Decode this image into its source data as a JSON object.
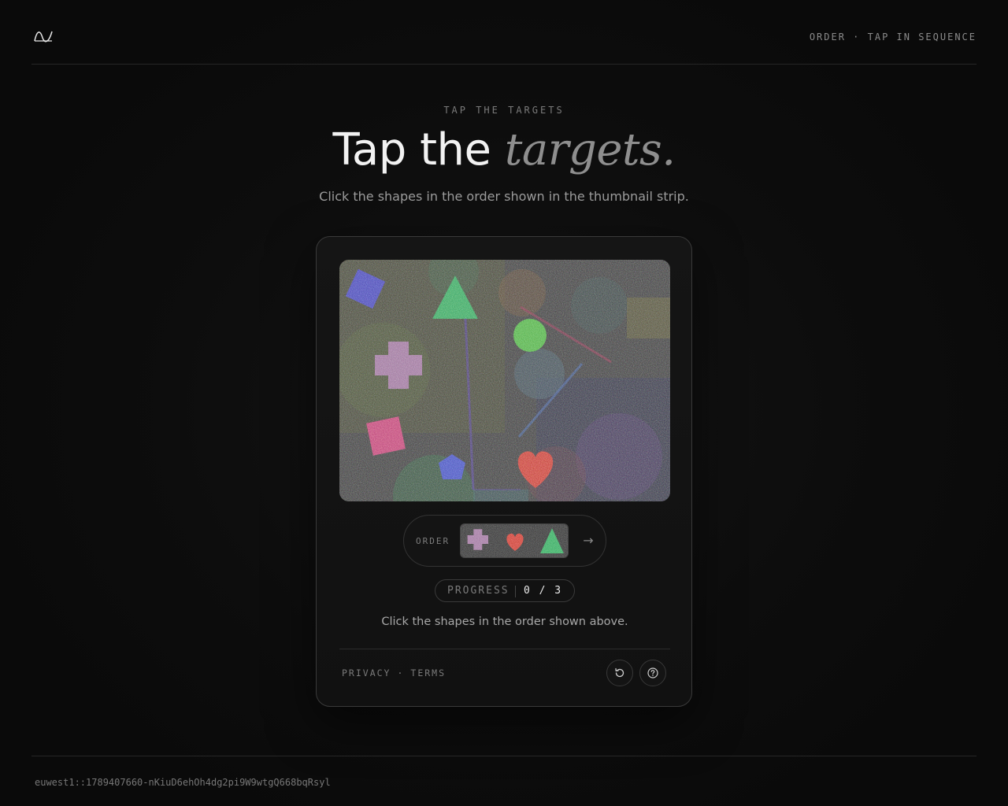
{
  "header": {
    "logo_icon": "wave-logo-icon",
    "tag": "ORDER · TAP IN SEQUENCE"
  },
  "hero": {
    "eyebrow": "TAP THE TARGETS",
    "title_main": "Tap the",
    "title_accent": "targets.",
    "subtitle": "Click the shapes in the order shown in the thumbnail strip."
  },
  "challenge": {
    "shapes": [
      {
        "name": "blue-square",
        "color": "#4d4dd6"
      },
      {
        "name": "green-triangle",
        "color": "#2ec46f"
      },
      {
        "name": "green-circle",
        "color": "#5ccf4a"
      },
      {
        "name": "pink-cross",
        "color": "#b98ab8"
      },
      {
        "name": "pink-square",
        "color": "#e0478c"
      },
      {
        "name": "blue-pentagon",
        "color": "#4a5de0"
      },
      {
        "name": "red-heart",
        "color": "#e8402c"
      }
    ],
    "order_label": "ORDER",
    "order_sequence": [
      "pink-cross",
      "red-heart",
      "green-triangle"
    ],
    "next_icon": "arrow-right-icon",
    "progress_label": "PROGRESS",
    "progress_value": "0 / 3",
    "instruction": "Click the shapes in the order shown above."
  },
  "card_footer": {
    "privacy": "PRIVACY",
    "separator": "·",
    "terms": "TERMS",
    "refresh_icon": "refresh-icon",
    "help_icon": "help-icon"
  },
  "footer": {
    "session_id": "euwest1::1789407660-nKiuD6ehOh4dg2pi9W9wtgQ668bqRsyl"
  }
}
